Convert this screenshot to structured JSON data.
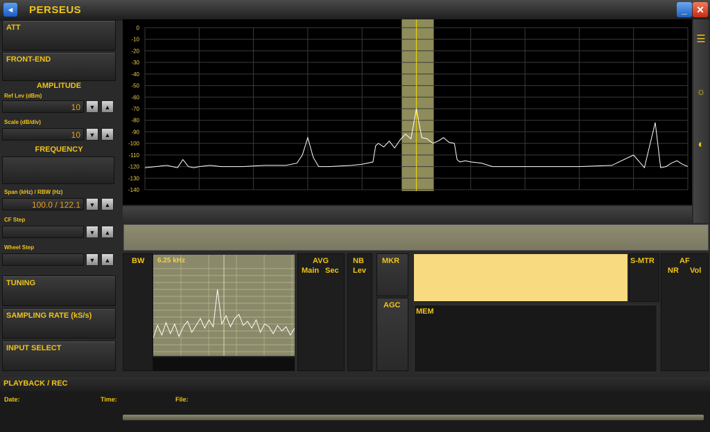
{
  "app": {
    "title": "PERSEUS"
  },
  "left_panel": {
    "att": "ATT",
    "front_end": "FRONT-END",
    "amplitude": "AMPLITUDE",
    "ref_lev_label": "Ref Lev (dBm)",
    "ref_lev_value": "10",
    "scale_label": "Scale (dB/div)",
    "scale_value": "10",
    "frequency": "FREQUENCY",
    "span_label": "Span (kHz) / RBW (Hz)",
    "span_value": "100.0 / 122.1",
    "cf_step_label": "CF Step",
    "wheel_step_label": "Wheel Step",
    "tuning": "TUNING",
    "sampling_rate": "SAMPLING RATE (kS/s)",
    "input_select": "INPUT SELECT"
  },
  "bottom": {
    "bw_label": "BW",
    "bw_value": "6.25 kHz",
    "avg_label": "AVG",
    "avg_main": "Main",
    "avg_sec": "Sec",
    "nb_label": "NB",
    "nb_lev": "Lev",
    "mkr_label": "MKR",
    "agc_label": "AGC",
    "smtr_label": "S-MTR",
    "mem_label": "MEM",
    "af_label": "AF",
    "af_nr": "NR",
    "af_vol": "Vol",
    "playback": "PLAYBACK / REC",
    "date_label": "Date:",
    "time_label": "Time:",
    "file_label": "File:"
  },
  "chart_data": {
    "type": "line",
    "title": "",
    "xlabel": "",
    "ylabel": "",
    "ylim": [
      -140,
      0
    ],
    "yticks": [
      "0",
      "-10",
      "-20",
      "-30",
      "-40",
      "-50",
      "-60",
      "-70",
      "-80",
      "-90",
      "-100",
      "-110",
      "-120",
      "-130",
      "-140"
    ],
    "x": [
      0,
      2,
      4,
      6,
      7,
      8,
      9,
      10,
      12,
      14,
      18,
      22,
      26,
      28,
      29,
      30,
      31,
      32,
      34,
      38,
      40,
      42,
      42.5,
      43,
      44,
      45,
      46,
      47,
      48,
      49,
      50,
      51,
      52,
      53,
      54,
      55,
      56,
      57,
      57.5,
      58,
      59,
      60,
      62,
      64,
      66,
      70,
      76,
      80,
      86,
      90,
      92,
      94,
      95,
      96,
      97,
      98,
      99,
      100
    ],
    "series": [
      {
        "name": "spectrum",
        "values": [
          -121,
          -120,
          -119,
          -121,
          -114,
          -120,
          -121,
          -120,
          -119,
          -120,
          -120,
          -119,
          -119,
          -117,
          -110,
          -95,
          -112,
          -120,
          -120,
          -119,
          -118,
          -116,
          -102,
          -100,
          -103,
          -98,
          -104,
          -97,
          -92,
          -96,
          -70,
          -95,
          -96,
          -100,
          -98,
          -95,
          -99,
          -100,
          -114,
          -116,
          -115,
          -116,
          -117,
          -120,
          -120,
          -120,
          -120,
          -120,
          -119,
          -110,
          -121,
          -82,
          -121,
          -120,
          -117,
          -115,
          -118,
          -120
        ]
      }
    ],
    "center_marker_x": 50,
    "passband": [
      47.3,
      53.2
    ],
    "grid": true
  },
  "bw_chart": {
    "values": [
      -5,
      4,
      -3,
      6,
      -2,
      5,
      -4,
      3,
      7,
      -1,
      4,
      9,
      2,
      8,
      3,
      30,
      5,
      11,
      3,
      9,
      12,
      4,
      7,
      2,
      8,
      -1,
      5,
      3,
      -2,
      4,
      0,
      3,
      -3,
      2
    ]
  },
  "colors": {
    "accent": "#f0c419",
    "trace": "#ffffff",
    "passband": "#8e8c5a",
    "marker": "#e8d000"
  }
}
